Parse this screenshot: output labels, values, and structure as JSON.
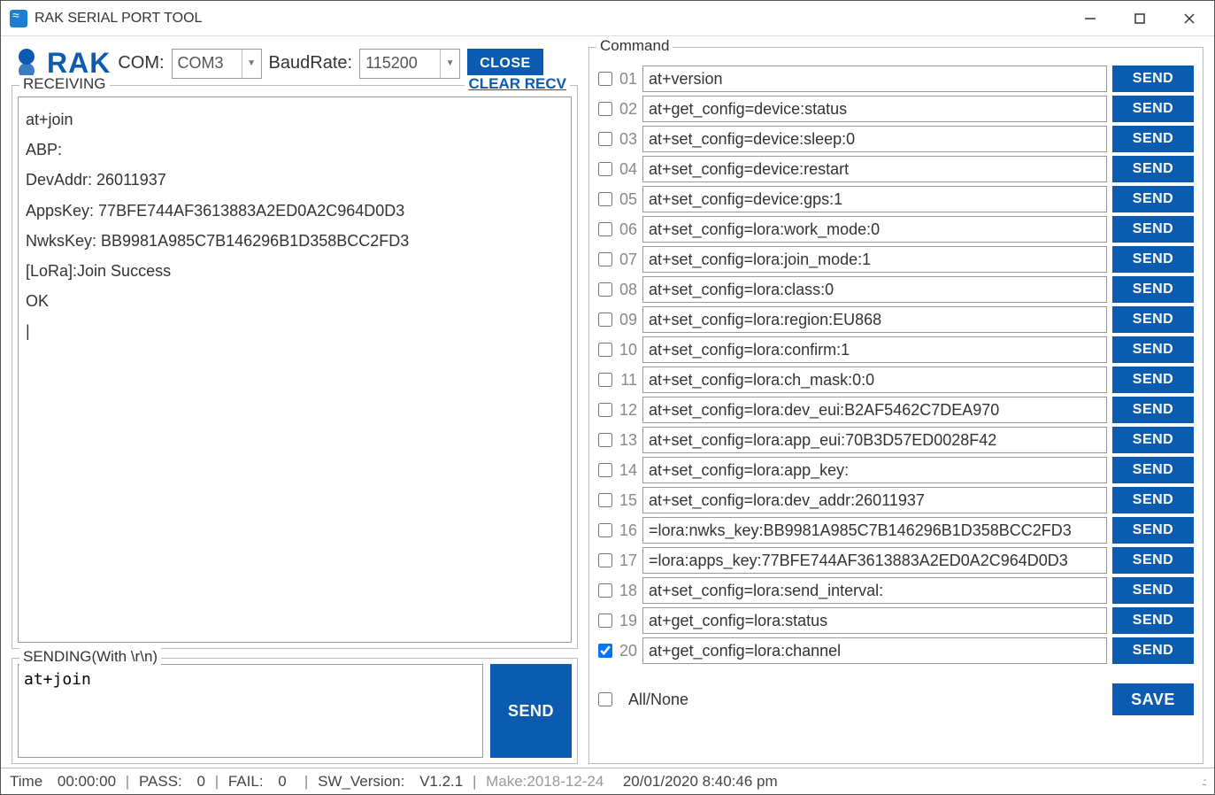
{
  "window": {
    "title": "RAK SERIAL PORT TOOL"
  },
  "top": {
    "logo": "RAK",
    "com_label": "COM:",
    "com_value": "COM3",
    "baud_label": "BaudRate:",
    "baud_value": "115200",
    "close": "CLOSE"
  },
  "recv": {
    "title": "RECEIVING",
    "clear": "CLEAR RECV",
    "text": "at+join\nABP:\nDevAddr: 26011937\nAppsKey: 77BFE744AF3613883A2ED0A2C964D0D3\nNwksKey: BB9981A985C7B146296B1D358BCC2FD3\n[LoRa]:Join Success\nOK\n|"
  },
  "send": {
    "title": "SENDING(With \\r\\n)",
    "value": "at+join",
    "button": "SEND"
  },
  "commands": {
    "title": "Command",
    "send_label": "SEND",
    "all_none": "All/None",
    "save": "SAVE",
    "rows": [
      {
        "n": "01",
        "checked": false,
        "cmd": "at+version"
      },
      {
        "n": "02",
        "checked": false,
        "cmd": "at+get_config=device:status"
      },
      {
        "n": "03",
        "checked": false,
        "cmd": "at+set_config=device:sleep:0"
      },
      {
        "n": "04",
        "checked": false,
        "cmd": "at+set_config=device:restart"
      },
      {
        "n": "05",
        "checked": false,
        "cmd": "at+set_config=device:gps:1"
      },
      {
        "n": "06",
        "checked": false,
        "cmd": "at+set_config=lora:work_mode:0"
      },
      {
        "n": "07",
        "checked": false,
        "cmd": "at+set_config=lora:join_mode:1"
      },
      {
        "n": "08",
        "checked": false,
        "cmd": "at+set_config=lora:class:0"
      },
      {
        "n": "09",
        "checked": false,
        "cmd": "at+set_config=lora:region:EU868"
      },
      {
        "n": "10",
        "checked": false,
        "cmd": "at+set_config=lora:confirm:1"
      },
      {
        "n": "11",
        "checked": false,
        "cmd": "at+set_config=lora:ch_mask:0:0"
      },
      {
        "n": "12",
        "checked": false,
        "cmd": "at+set_config=lora:dev_eui:B2AF5462C7DEA970"
      },
      {
        "n": "13",
        "checked": false,
        "cmd": "at+set_config=lora:app_eui:70B3D57ED0028F42"
      },
      {
        "n": "14",
        "checked": false,
        "cmd": "at+set_config=lora:app_key:"
      },
      {
        "n": "15",
        "checked": false,
        "cmd": "at+set_config=lora:dev_addr:26011937"
      },
      {
        "n": "16",
        "checked": false,
        "cmd": "=lora:nwks_key:BB9981A985C7B146296B1D358BCC2FD3"
      },
      {
        "n": "17",
        "checked": false,
        "cmd": "=lora:apps_key:77BFE744AF3613883A2ED0A2C964D0D3"
      },
      {
        "n": "18",
        "checked": false,
        "cmd": "at+set_config=lora:send_interval:"
      },
      {
        "n": "19",
        "checked": false,
        "cmd": "at+get_config=lora:status"
      },
      {
        "n": "20",
        "checked": true,
        "cmd": "at+get_config=lora:channel"
      }
    ]
  },
  "status": {
    "time_label": "Time",
    "time": "00:00:00",
    "pass_label": "PASS:",
    "pass": "0",
    "fail_label": "FAIL:",
    "fail": "0",
    "sw_label": "SW_Version:",
    "sw": "V1.2.1",
    "make": "Make:2018-12-24",
    "now": "20/01/2020 8:40:46 pm"
  }
}
